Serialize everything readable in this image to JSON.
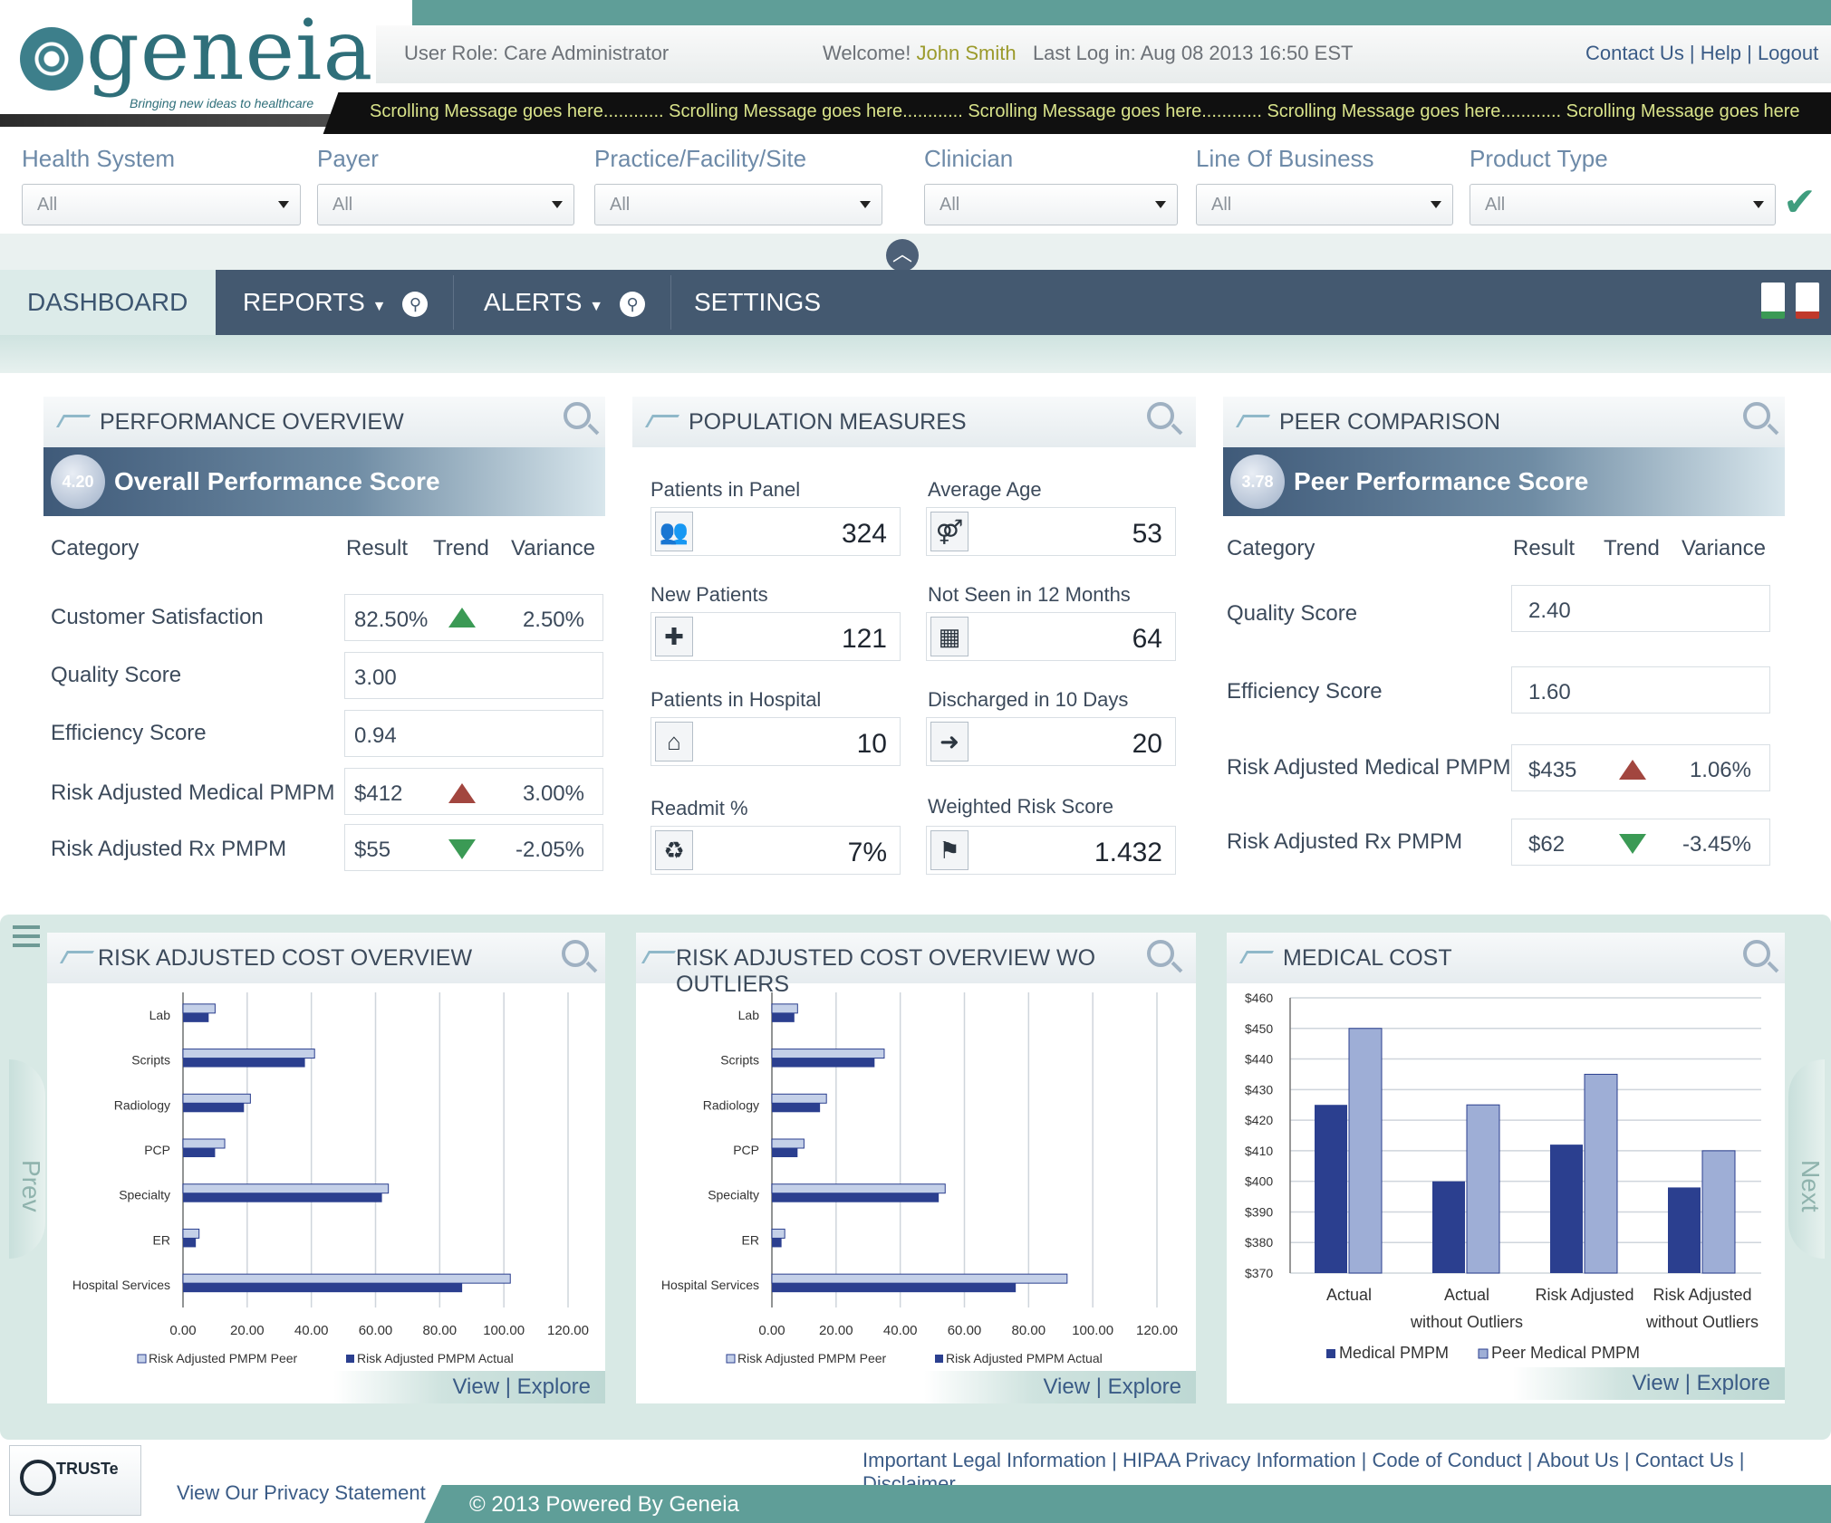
{
  "brand": {
    "name": "geneia",
    "tagline": "Bringing new ideas to healthcare"
  },
  "header": {
    "user_role": "User Role: Care Administrator",
    "welcome_prefix": "Welcome!",
    "user_name": "John Smith",
    "last_login": "Last Log in: Aug 08 2013 16:50 EST",
    "links": "Contact Us | Help | Logout",
    "ticker": "Scrolling Message goes here............  Scrolling Message goes here............  Scrolling Message goes here............  Scrolling Message goes here............  Scrolling Message goes here"
  },
  "filters": [
    {
      "label": "Health System",
      "value": "All"
    },
    {
      "label": "Payer",
      "value": "All"
    },
    {
      "label": "Practice/Facility/Site",
      "value": "All"
    },
    {
      "label": "Clinician",
      "value": "All"
    },
    {
      "label": "Line Of Business",
      "value": "All"
    },
    {
      "label": "Product Type",
      "value": "All"
    }
  ],
  "nav": {
    "dashboard": "DASHBOARD",
    "reports": "REPORTS",
    "alerts": "ALERTS",
    "settings": "SETTINGS"
  },
  "performance": {
    "title": "PERFORMANCE OVERVIEW",
    "score": "4.20",
    "score_label": "Overall Performance Score",
    "headers": [
      "Category",
      "Result",
      "Trend",
      "Variance"
    ],
    "rows": [
      {
        "label": "Customer Satisfaction",
        "result": "82.50%",
        "trend": "up",
        "variance": "2.50%"
      },
      {
        "label": "Quality Score",
        "result": "3.00",
        "trend": "",
        "variance": ""
      },
      {
        "label": "Efficiency Score",
        "result": "0.94",
        "trend": "",
        "variance": ""
      },
      {
        "label": "Risk Adjusted Medical PMPM",
        "result": "$412",
        "trend": "up-red",
        "variance": "3.00%"
      },
      {
        "label": "Risk Adjusted Rx PMPM",
        "result": "$55",
        "trend": "down",
        "variance": "-2.05%"
      }
    ]
  },
  "population": {
    "title": "POPULATION MEASURES",
    "items": [
      {
        "label": "Patients in Panel",
        "value": "324",
        "icon": "people-icon"
      },
      {
        "label": "Average Age",
        "value": "53",
        "icon": "couple-icon"
      },
      {
        "label": "New Patients",
        "value": "121",
        "icon": "new-patient-icon"
      },
      {
        "label": "Not Seen in 12 Months",
        "value": "64",
        "icon": "calendar-icon"
      },
      {
        "label": "Patients in Hospital",
        "value": "10",
        "icon": "hospital-icon"
      },
      {
        "label": "Discharged in 10 Days",
        "value": "20",
        "icon": "discharge-icon"
      },
      {
        "label": "Readmit %",
        "value": "7%",
        "icon": "readmit-icon"
      },
      {
        "label": "Weighted Risk Score",
        "value": "1.432",
        "icon": "risk-icon"
      }
    ]
  },
  "peer": {
    "title": "PEER COMPARISON",
    "score": "3.78",
    "score_label": "Peer Performance Score",
    "headers": [
      "Category",
      "Result",
      "Trend",
      "Variance"
    ],
    "rows": [
      {
        "label": "Quality Score",
        "result": "2.40",
        "trend": "",
        "variance": ""
      },
      {
        "label": "Efficiency Score",
        "result": "1.60",
        "trend": "",
        "variance": ""
      },
      {
        "label": "Risk Adjusted Medical PMPM",
        "result": "$435",
        "trend": "up-red",
        "variance": "1.06%"
      },
      {
        "label": "Risk Adjusted Rx PMPM",
        "result": "$62",
        "trend": "down",
        "variance": "-3.45%"
      }
    ]
  },
  "chart_panels": {
    "c1_title": "RISK ADJUSTED COST OVERVIEW",
    "c2_title": "RISK ADJUSTED COST OVERVIEW WO OUTLIERS",
    "c3_title": "MEDICAL COST",
    "view_explore": "View | Explore",
    "prev": "Prev",
    "next": "Next"
  },
  "chart_data": [
    {
      "type": "bar",
      "orientation": "horizontal",
      "categories": [
        "Lab",
        "Scripts",
        "Radiology",
        "PCP",
        "Specialty",
        "ER",
        "Hospital Services"
      ],
      "series": [
        {
          "name": "Risk Adjusted PMPM Peer",
          "values": [
            10,
            41,
            21,
            13,
            64,
            5,
            102
          ]
        },
        {
          "name": "Risk Adjusted PMPM Actual",
          "values": [
            8,
            38,
            19,
            10,
            62,
            4,
            87
          ]
        }
      ],
      "xlim": [
        0,
        120
      ],
      "xticks": [
        "0.00",
        "20.00",
        "40.00",
        "60.00",
        "80.00",
        "100.00",
        "120.00"
      ],
      "colors": {
        "peer": "#c4d0e8",
        "actual": "#2b3f8f"
      }
    },
    {
      "type": "bar",
      "orientation": "horizontal",
      "categories": [
        "Lab",
        "Scripts",
        "Radiology",
        "PCP",
        "Specialty",
        "ER",
        "Hospital Services"
      ],
      "series": [
        {
          "name": "Risk Adjusted PMPM Peer",
          "values": [
            8,
            35,
            17,
            10,
            54,
            4,
            92
          ]
        },
        {
          "name": "Risk Adjusted PMPM Actual",
          "values": [
            7,
            32,
            15,
            8,
            52,
            3,
            76
          ]
        }
      ],
      "xlim": [
        0,
        120
      ],
      "xticks": [
        "0.00",
        "20.00",
        "40.00",
        "60.00",
        "80.00",
        "100.00",
        "120.00"
      ],
      "colors": {
        "peer": "#c4d0e8",
        "actual": "#2b3f8f"
      }
    },
    {
      "type": "bar",
      "orientation": "vertical",
      "categories": [
        "Actual",
        "Actual without Outliers",
        "Risk Adjusted",
        "Risk Adjusted without Outliers"
      ],
      "series": [
        {
          "name": "Medical PMPM",
          "values": [
            425,
            400,
            412,
            398
          ]
        },
        {
          "name": "Peer Medical PMPM",
          "values": [
            450,
            425,
            435,
            410
          ]
        }
      ],
      "ylim": [
        370,
        460
      ],
      "yticks": [
        "$460",
        "$450",
        "$440",
        "$430",
        "$420",
        "$410",
        "$400",
        "$390",
        "$380",
        "$370"
      ],
      "colors": {
        "medical": "#2b3f8f",
        "peer": "#9eaed6"
      }
    }
  ],
  "footer": {
    "links": "Important Legal Information | HIPAA Privacy Information | Code of Conduct | About Us | Contact Us | Disclaimer",
    "copyright": "© 2013 Powered By Geneia",
    "privacy": "View Our Privacy Statement",
    "truste": "TRUSTe"
  }
}
